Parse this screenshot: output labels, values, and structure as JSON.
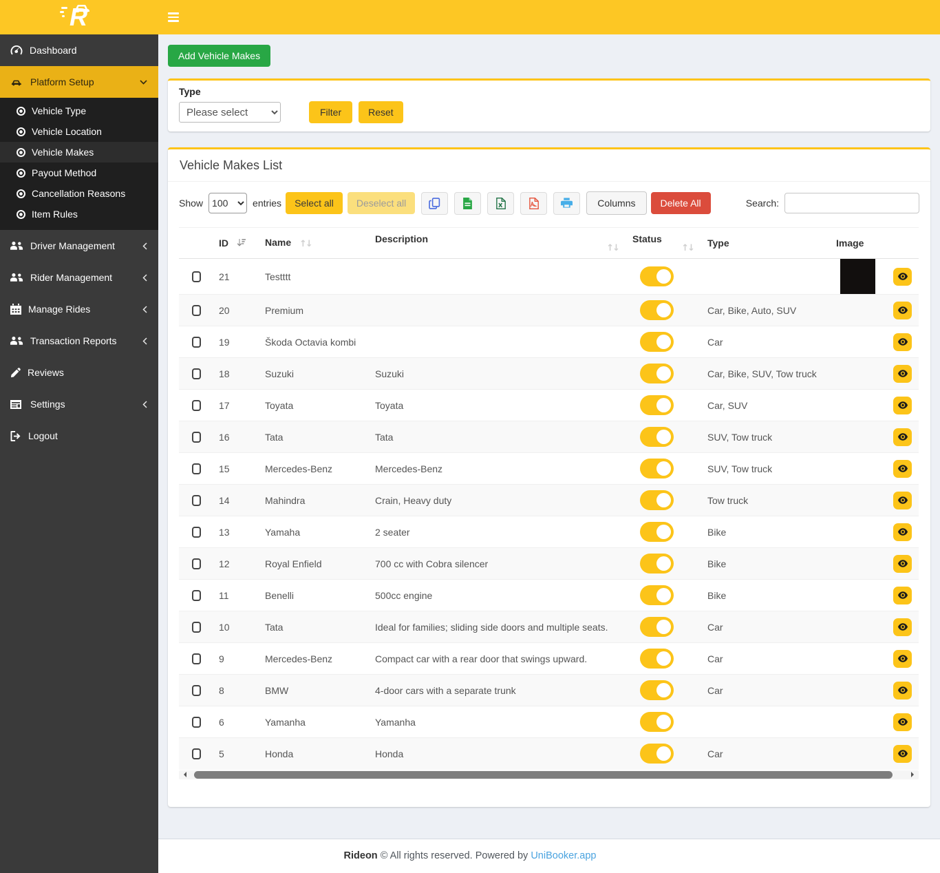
{
  "colors": {
    "navbar_yellow": "#fdc724",
    "sidebar_dark": "#3a3a3a",
    "submenu_dark": "#1f1f1f",
    "active_item_yellow": "#eab116",
    "button_yellow": "#fcc419",
    "deselect_yellow": "#fbdf7d",
    "add_green": "#28a745",
    "delete_red": "#db4c3c",
    "link_blue": "#4aa3df"
  },
  "brand": {
    "logo_letter": "R"
  },
  "icons": {
    "hamburger-icon": "☰",
    "dashboard-icon": "speedometer",
    "car-icon": "car",
    "bullet-icon": "dot-circle",
    "users-icon": "user-group",
    "calendar-icon": "calendar",
    "pen-icon": "pen",
    "list-icon": "list-panel",
    "logout-icon": "sign-out",
    "chevron-down-icon": "v",
    "chevron-left-icon": "<",
    "copy-icon": "copy-pages",
    "csv-icon": "file-lines-green",
    "excel-icon": "file-x-green",
    "pdf-icon": "file-red",
    "print-icon": "printer-blue",
    "eye-icon": "eye",
    "sort-desc-icon": "arrow-down-bars",
    "sort-both-icon": "↑↓"
  },
  "sidebar": {
    "dashboard": "Dashboard",
    "platform_setup": "Platform Setup",
    "submenu": [
      {
        "label": "Vehicle Type"
      },
      {
        "label": "Vehicle Location"
      },
      {
        "label": "Vehicle Makes",
        "active": true
      },
      {
        "label": "Payout Method"
      },
      {
        "label": "Cancellation Reasons"
      },
      {
        "label": "Item Rules"
      }
    ],
    "lower": [
      {
        "label": "Driver Management"
      },
      {
        "label": "Rider Management"
      },
      {
        "label": "Manage Rides"
      },
      {
        "label": "Transaction Reports"
      },
      {
        "label": "Reviews"
      },
      {
        "label": "Settings"
      },
      {
        "label": "Logout"
      }
    ]
  },
  "page": {
    "add_button": "Add Vehicle Makes",
    "list_title": "Vehicle Makes List"
  },
  "filter": {
    "type_label": "Type",
    "type_value": "Please select",
    "filter_button": "Filter",
    "reset_button": "Reset"
  },
  "controls": {
    "show_label": "Show",
    "page_length": "100",
    "entries_label": "entries",
    "select_all": "Select all",
    "deselect_all": "Deselect all",
    "columns": "Columns",
    "delete_all": "Delete All",
    "search_label": "Search:",
    "search_value": ""
  },
  "table": {
    "headers": [
      {
        "label": "ID",
        "sort": "desc"
      },
      {
        "label": "Name",
        "sort": "both"
      },
      {
        "label": "Description",
        "sort": "both"
      },
      {
        "label": "Status",
        "sort": "both"
      },
      {
        "label": "Type",
        "sort": "none"
      },
      {
        "label": "Image",
        "sort": "none"
      }
    ],
    "rows": [
      {
        "id": "21",
        "name": "Testttt",
        "description": "",
        "status": "on",
        "type": "",
        "image": true
      },
      {
        "id": "20",
        "name": "Premium",
        "description": "",
        "status": "on",
        "type": "Car, Bike, Auto, SUV",
        "image": false
      },
      {
        "id": "19",
        "name": "Škoda Octavia kombi",
        "description": "",
        "status": "on",
        "type": "Car",
        "image": false
      },
      {
        "id": "18",
        "name": "Suzuki",
        "description": "Suzuki",
        "status": "on",
        "type": "Car, Bike, SUV, Tow truck",
        "image": false
      },
      {
        "id": "17",
        "name": "Toyata",
        "description": "Toyata",
        "status": "on",
        "type": "Car, SUV",
        "image": false
      },
      {
        "id": "16",
        "name": "Tata",
        "description": "Tata",
        "status": "on",
        "type": "SUV, Tow truck",
        "image": false
      },
      {
        "id": "15",
        "name": "Mercedes-Benz",
        "description": "Mercedes-Benz",
        "status": "on",
        "type": "SUV, Tow truck",
        "image": false
      },
      {
        "id": "14",
        "name": "Mahindra",
        "description": "Crain, Heavy duty",
        "status": "on",
        "type": "Tow truck",
        "image": false
      },
      {
        "id": "13",
        "name": "Yamaha",
        "description": "2 seater",
        "status": "on",
        "type": "Bike",
        "image": false
      },
      {
        "id": "12",
        "name": "Royal Enfield",
        "description": "700 cc with Cobra silencer",
        "status": "on",
        "type": "Bike",
        "image": false
      },
      {
        "id": "11",
        "name": "Benelli",
        "description": "500cc engine",
        "status": "on",
        "type": "Bike",
        "image": false
      },
      {
        "id": "10",
        "name": "Tata",
        "description": "Ideal for families; sliding side doors and multiple seats.",
        "status": "on",
        "type": "Car",
        "image": false
      },
      {
        "id": "9",
        "name": "Mercedes-Benz",
        "description": "Compact car with a rear door that swings upward.",
        "status": "on",
        "type": "Car",
        "image": false
      },
      {
        "id": "8",
        "name": "BMW",
        "description": "4-door cars with a separate trunk",
        "status": "on",
        "type": "Car",
        "image": false
      },
      {
        "id": "6",
        "name": "Yamanha",
        "description": "Yamanha",
        "status": "on",
        "type": "",
        "image": false
      },
      {
        "id": "5",
        "name": "Honda",
        "description": "Honda",
        "status": "on",
        "type": "Car",
        "image": false
      }
    ]
  },
  "footer": {
    "brand": "Rideon",
    "text": "© All rights reserved. Powered by",
    "link": "UniBooker.app"
  }
}
